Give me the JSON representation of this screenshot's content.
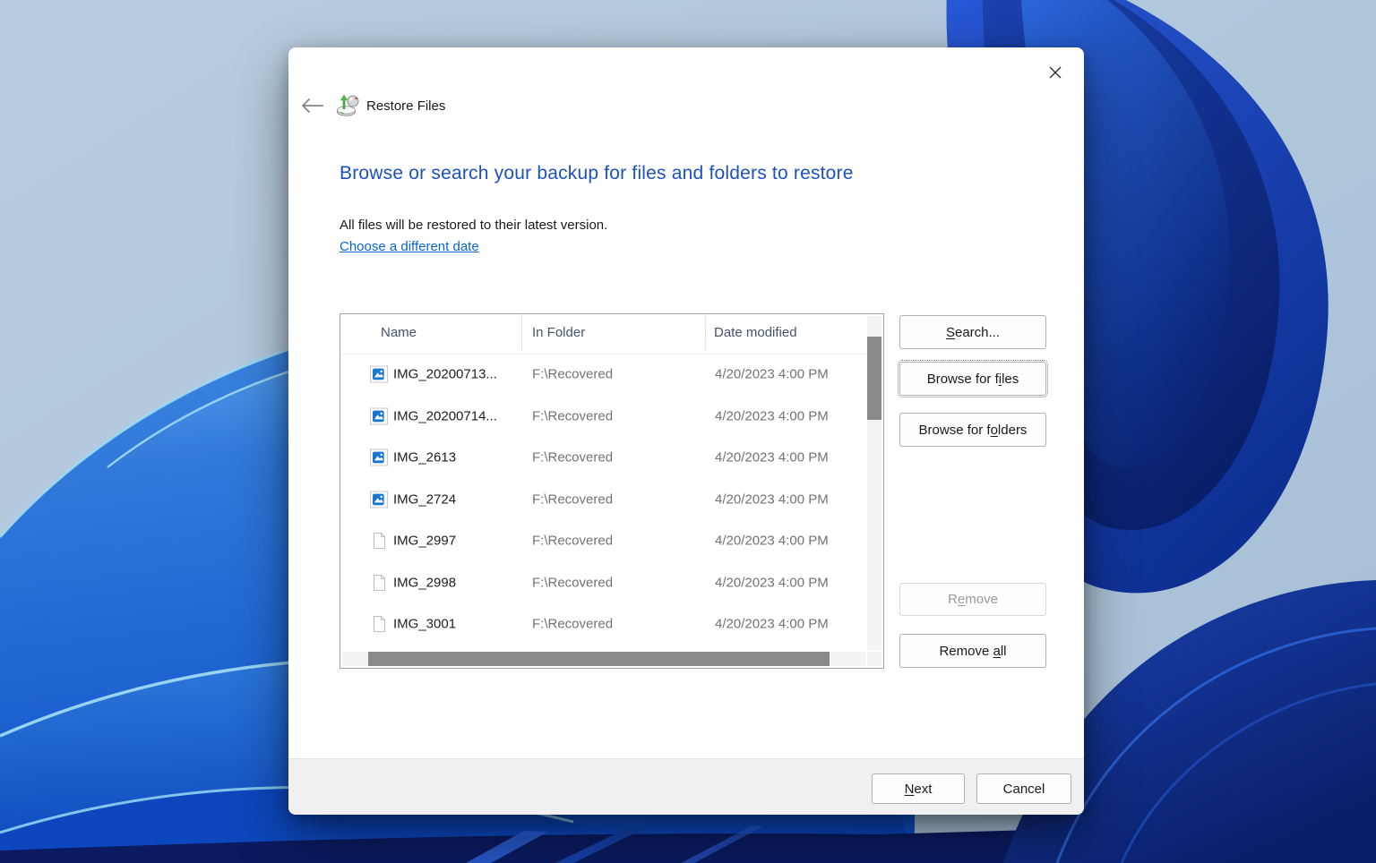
{
  "window": {
    "title": "Restore Files"
  },
  "intro": {
    "heading": "Browse or search your backup for files and folders to restore",
    "subtext": "All files will be restored to their latest version.",
    "link_label": "Choose a different date"
  },
  "table": {
    "columns": [
      "Name",
      "In Folder",
      "Date modified"
    ],
    "rows": [
      {
        "icon": "image",
        "name": "IMG_20200713...",
        "folder": "F:\\Recovered",
        "date": "4/20/2023 4:00 PM"
      },
      {
        "icon": "image",
        "name": "IMG_20200714...",
        "folder": "F:\\Recovered",
        "date": "4/20/2023 4:00 PM"
      },
      {
        "icon": "image",
        "name": "IMG_2613",
        "folder": "F:\\Recovered",
        "date": "4/20/2023 4:00 PM"
      },
      {
        "icon": "image",
        "name": "IMG_2724",
        "folder": "F:\\Recovered",
        "date": "4/20/2023 4:00 PM"
      },
      {
        "icon": "file",
        "name": "IMG_2997",
        "folder": "F:\\Recovered",
        "date": "4/20/2023 4:00 PM"
      },
      {
        "icon": "file",
        "name": "IMG_2998",
        "folder": "F:\\Recovered",
        "date": "4/20/2023 4:00 PM"
      },
      {
        "icon": "file",
        "name": "IMG_3001",
        "folder": "F:\\Recovered",
        "date": "4/20/2023 4:00 PM"
      }
    ]
  },
  "side_buttons": {
    "search": {
      "pre": "",
      "accel": "S",
      "post": "earch..."
    },
    "browse_files": {
      "pre": "Browse for f",
      "accel": "i",
      "post": "les",
      "focused": true
    },
    "browse_folders": {
      "pre": "Browse for f",
      "accel": "o",
      "post": "lders"
    },
    "remove": {
      "pre": "R",
      "accel": "e",
      "post": "move",
      "disabled": true
    },
    "remove_all": {
      "pre": "Remove ",
      "accel": "a",
      "post": "ll"
    }
  },
  "footer_buttons": {
    "next": {
      "pre": "",
      "accel": "N",
      "post": "ext"
    },
    "cancel": {
      "pre": "Cancel",
      "accel": "",
      "post": ""
    }
  },
  "icons": {
    "back": "left-arrow",
    "app": "restore-files-drive-with-green-arrows",
    "close": "x",
    "row_image": "blue-image-thumbnail",
    "row_file": "blank-document"
  },
  "colors": {
    "heading": "#1c51c4",
    "link": "#0a64cc",
    "footer_bg": "#f0f0f0",
    "scroll_thumb": "#8a8a8a",
    "wallpaper_light": "#aec6dc",
    "wallpaper_blue": "#1e63d6",
    "wallpaper_dark": "#0a1f66"
  }
}
